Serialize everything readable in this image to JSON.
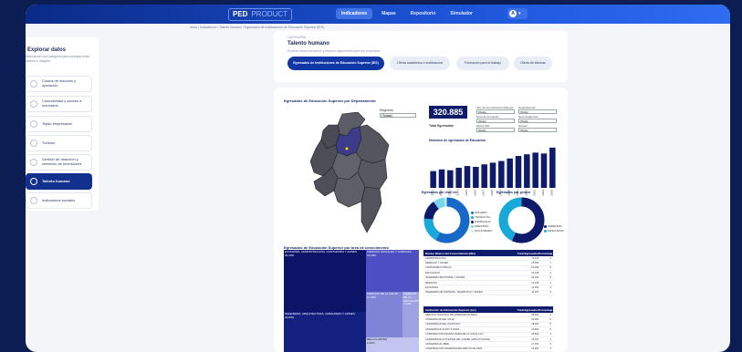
{
  "header": {
    "logo_primary": "PED",
    "logo_secondary": "PRODUCT",
    "nav": [
      "Indicadores",
      "Mapas",
      "Repositorio",
      "Simulador"
    ],
    "active_nav": 0,
    "avatar_initial": "A"
  },
  "breadcrumb": "Inicio / Indicadores / Talento humano / Egresados de Instituciones de Educación Superior (IES)",
  "sidebar": {
    "title": "Explorar datos",
    "subtitle": "Seleccione una categoría para navegar entre visores e insights.",
    "items": [
      {
        "label": "Costos de insumos y operación",
        "icon": "cost-icon"
      },
      {
        "label": "Conectividad y acceso a mercados",
        "icon": "network-icon"
      },
      {
        "label": "Tejido empresarial",
        "icon": "building-icon"
      },
      {
        "label": "Turismo",
        "icon": "plane-icon"
      },
      {
        "label": "Gestión de atracción y retención de inversiones",
        "icon": "briefcase-icon"
      },
      {
        "label": "Talento humano",
        "icon": "people-icon"
      },
      {
        "label": "Indicadores sociales",
        "icon": "chart-icon"
      }
    ],
    "active": 5
  },
  "category": {
    "label": "CATEGORÍA",
    "title": "Talento humano",
    "description": "Explora datos formación y empleo disponibles para tus proyectos.",
    "pills": [
      "Egresados de Instituciones de Educación Superior (IES)",
      "Oferta académica e institucional",
      "Formación para el trabajo",
      "Oferta de idiomas"
    ],
    "active_pill": 0
  },
  "dashboard": {
    "title": "Egresados de Educación Superior por Departamento",
    "region_label": "Regiones",
    "region_value": "(Todas)",
    "kpi_value": "320.885",
    "kpi_label": "Total Egresados",
    "filters": [
      {
        "label": "Año de Conocimiento (Rango)",
        "value": "(Todo)"
      },
      {
        "label": "Departamento",
        "value": "(Todo)"
      },
      {
        "label": "Nivel de formación",
        "value": "(Todo)"
      },
      {
        "label": "Nivel Académico",
        "value": "(Todo)"
      },
      {
        "label": "Sector IES",
        "value": "(Todo)"
      },
      {
        "label": "Género",
        "value": "(Todo)"
      }
    ],
    "bar_title": "Histórico de egresados de Educación",
    "donut1_title": "Egresados por nivel de",
    "donut2_title": "Egresados por género",
    "donut1_legend": [
      "UNIVERS...",
      "TECNOLÓG...",
      "ESPECIALIZ...",
      "MAESTRÍA",
      "DOCTORADO"
    ],
    "donut2_legend": [
      "FEMENINO",
      "MASCULINO"
    ],
    "treemap_title": "Egresados de Educación Superior por área de conocimiento",
    "treemap": [
      {
        "label": "ECONOMÍA, ADMINISTRACIÓN, CONTADURÍA Y AFINES",
        "pct": "36,43%",
        "color": "#0b1466"
      },
      {
        "label": "INGENIERÍA, ARQUITECTURA, URBANISMO Y AFINES",
        "pct": "23,89%",
        "color": "#13207f"
      },
      {
        "label": "CIENCIAS SOCIALES Y HUMANAS",
        "pct": "16,38%",
        "color": "#4b4fc2"
      },
      {
        "label": "CIENCIAS DE LA SALUD",
        "pct": "11,29%",
        "color": "#7f84d6"
      },
      {
        "label": "CIENCIAS DE LA EDUCACIÓN",
        "pct": "7,14%",
        "color": "#9ea2e0"
      },
      {
        "label": "BELLAS ARTES",
        "pct": "2,30%",
        "color": "#c2c5ef"
      }
    ],
    "table1": {
      "headers": [
        "Núcleo Básico del Conocimiento (Nbc)",
        "Total Egresados",
        "Porcentaje"
      ],
      "rows": [
        [
          "ADMINISTRACIÓN",
          "72.315",
          "2"
        ],
        [
          "DERECHO Y AFINES",
          "25.250",
          "7"
        ],
        [
          "CONTADURÍA PÚBLICA",
          "22.009",
          "6"
        ],
        [
          "EDUCACIÓN",
          "22.108",
          "6"
        ],
        [
          "INGENIERÍA INDUSTRIAL Y AFINES",
          "20.190",
          "6"
        ],
        [
          "MEDICINA",
          "13.208",
          "4"
        ],
        [
          "ECONOMÍA",
          "12.050",
          "3"
        ],
        [
          "INGENIERÍA DE SISTEMAS, TELEMÁTICA Y AFINES",
          "11.073",
          "3"
        ]
      ]
    },
    "table2": {
      "headers": [
        "Institución de Educación Superior (Ies)",
        "Total Egresados",
        "Porcentaje"
      ],
      "rows": [
        [
          "SERVICIO NACIONAL DE APRENDIZAJE-SENA",
          "28.300",
          "9"
        ],
        [
          "UNIVERSIDAD DEL VALLE",
          "20.000",
          "6"
        ],
        [
          "UNIVERSIDAD DEL ATLÁNTICO",
          "18.200",
          "5"
        ],
        [
          "UNIVERSIDAD SANTO TOMÁS",
          "16.500",
          "5"
        ],
        [
          "CORPORACIÓN UNIVERSITARIA DE LA COSTA CUC",
          "15.800",
          "4"
        ],
        [
          "UNIVERSIDAD AUTÓNOMA DEL CARIBE (UNIAUTÓNOMA)",
          "14.100",
          "4"
        ],
        [
          "UNIVERSIDAD LIBRE",
          "17.352",
          "5"
        ],
        [
          "CORPORACIÓN UNIVERSITARIA MINUTO DE DIOS",
          "12.300",
          "3"
        ]
      ]
    }
  },
  "chart_data": [
    {
      "type": "bar",
      "title": "Histórico de egresados de Educación",
      "categories": [
        "2011",
        "2012",
        "2013",
        "2014",
        "2015",
        "2016",
        "2017",
        "2018",
        "2019",
        "2020",
        "2021",
        "2022",
        "2023",
        "2024",
        "2025"
      ],
      "values": [
        20,
        22,
        21,
        24,
        26,
        25,
        28,
        30,
        32,
        35,
        38,
        40,
        42,
        41,
        48
      ],
      "ylim": [
        0,
        50
      ],
      "color": "#0e1a6a"
    },
    {
      "type": "pie",
      "title": "Egresados por nivel de",
      "labels": [
        "UNIVERS...",
        "TECNOLÓG...",
        "ESPECIALIZ...",
        "MAESTRÍA",
        "DOCTORADO"
      ],
      "values": [
        58,
        18,
        14,
        8,
        2
      ],
      "colors": [
        "#1769c8",
        "#19a9d8",
        "#0e1a6a",
        "#7ad3ec",
        "#c9ecf7"
      ]
    },
    {
      "type": "pie",
      "title": "Egresados por género",
      "labels": [
        "FEMENINO",
        "MASCULINO"
      ],
      "values": [
        57,
        43
      ],
      "colors": [
        "#0e1a6a",
        "#19a9d8"
      ]
    }
  ]
}
